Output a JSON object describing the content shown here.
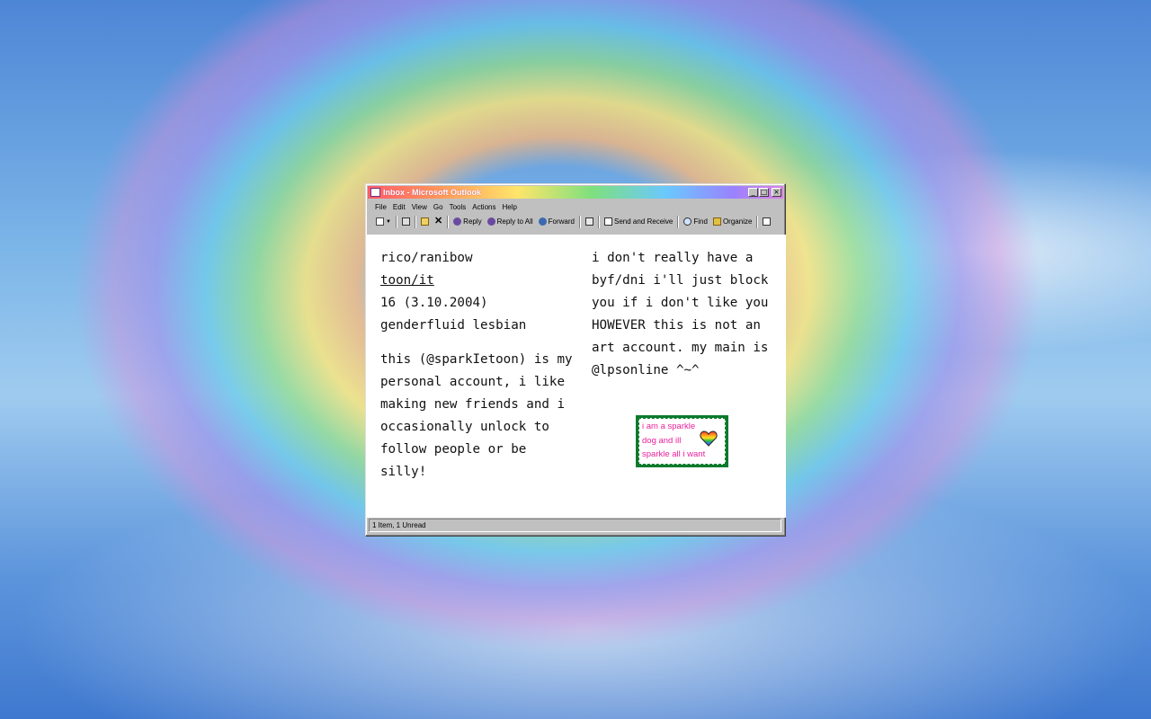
{
  "window": {
    "title": "Inbox - Microsoft Outlook",
    "min_label": "_",
    "max_label": "□",
    "close_label": "×"
  },
  "menu": [
    "File",
    "Edit",
    "View",
    "Go",
    "Tools",
    "Actions",
    "Help"
  ],
  "toolbar": {
    "reply": "Reply",
    "reply_all": "Reply to All",
    "forward": "Forward",
    "send_receive": "Send and Receive",
    "find": "Find",
    "organize": "Organize"
  },
  "bio": {
    "name": "rico/ranibow",
    "link": "toon/it",
    "age": "16 (3.10.2004)",
    "identity": "genderfluid lesbian",
    "para1": "this (@sparkIetoon) is my personal account, i like making new friends and i occasionally unlock to follow people or be silly!",
    "para2": "i don't really have a byf/dni i'll just block you if i don't like you",
    "para3": "HOWEVER this is not an art account. my main is @lpsonline ^~^"
  },
  "stamp": {
    "line1": "i am a sparkle",
    "line2": "dog and ill",
    "line3": "sparkle all i want"
  },
  "status": {
    "text": "1 Item, 1 Unread"
  },
  "colors": {
    "stamp_border": "#0d7a2c",
    "stamp_text": "#e8209a"
  }
}
